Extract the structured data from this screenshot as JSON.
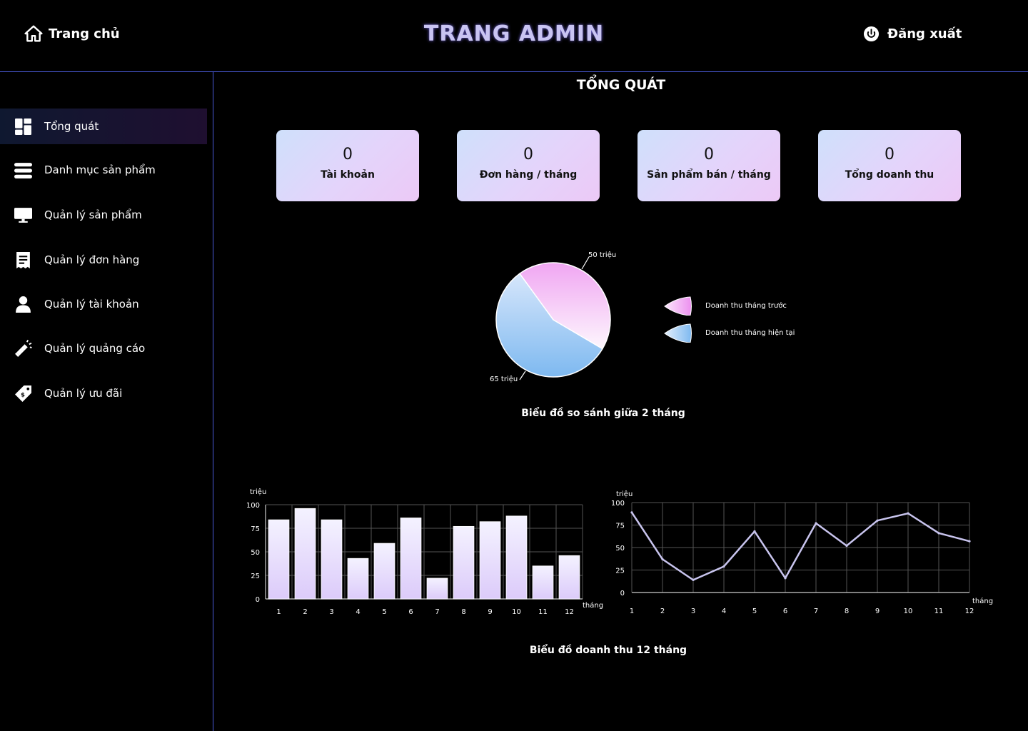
{
  "header": {
    "home_label": "Trang chủ",
    "title": "TRANG ADMIN",
    "logout_label": "Đăng xuất"
  },
  "sidebar": {
    "items": [
      {
        "label": "Tổng quát",
        "icon": "dashboard-icon"
      },
      {
        "label": "Danh mục sản phẩm",
        "icon": "list-icon"
      },
      {
        "label": "Quản lý sản phẩm",
        "icon": "monitor-icon"
      },
      {
        "label": "Quản lý đơn hàng",
        "icon": "receipt-icon"
      },
      {
        "label": "Quản lý tài khoản",
        "icon": "user-icon"
      },
      {
        "label": "Quản lý quảng cáo",
        "icon": "megaphone-icon"
      },
      {
        "label": "Quản lý ưu đãi",
        "icon": "discount-tag-icon"
      }
    ],
    "active_index": 0
  },
  "main": {
    "title": "TỔNG QUÁT",
    "stats": [
      {
        "value": "0",
        "label": "Tài khoản"
      },
      {
        "value": "0",
        "label": "Đơn hàng / tháng"
      },
      {
        "value": "0",
        "label": "Sản phẩm bán / tháng"
      },
      {
        "value": "0",
        "label": "Tổng doanh thu"
      }
    ],
    "pie_caption": "Biểu đồ so sánh giữa 2 tháng",
    "revenue_caption": "Biểu đồ doanh thu 12 tháng"
  },
  "colors": {
    "accent_line": "#4a5bd8",
    "title_color": "#c9c4f2",
    "pie_prev_start": "#f0a6f2",
    "pie_prev_end": "#fdf6fd",
    "pie_cur_start": "#d6e6fb",
    "pie_cur_end": "#7eb9f0",
    "bar_top": "#f4f2ff",
    "bar_bottom": "#dccbfa",
    "line_color": "#c8c4ee"
  },
  "chart_data": [
    {
      "type": "pie",
      "slices": [
        {
          "name": "Doanh thu tháng trước",
          "value": 50,
          "label": "50 triệu"
        },
        {
          "name": "Doanh thu tháng hiện tại",
          "value": 65,
          "label": "65 triệu"
        }
      ],
      "legend_placement": "right"
    },
    {
      "type": "bar",
      "categories": [
        "1",
        "2",
        "3",
        "4",
        "5",
        "6",
        "7",
        "8",
        "9",
        "10",
        "11",
        "12"
      ],
      "values": [
        84,
        96,
        84,
        43,
        59,
        86,
        22,
        77,
        82,
        88,
        35,
        46
      ],
      "ylabel": "triệu",
      "xlabel": "tháng",
      "ylim": [
        0,
        100
      ],
      "yticks": [
        "0",
        "25",
        "50",
        "75",
        "100"
      ],
      "grid": true
    },
    {
      "type": "line",
      "categories": [
        "1",
        "2",
        "3",
        "4",
        "5",
        "6",
        "7",
        "8",
        "9",
        "10",
        "11",
        "12"
      ],
      "values": [
        89,
        37,
        14,
        29,
        68,
        16,
        77,
        52,
        80,
        88,
        66,
        57
      ],
      "ylabel": "triệu",
      "xlabel": "tháng",
      "ylim": [
        0,
        100
      ],
      "yticks": [
        "0",
        "25",
        "50",
        "75",
        "100"
      ],
      "grid": true
    }
  ]
}
